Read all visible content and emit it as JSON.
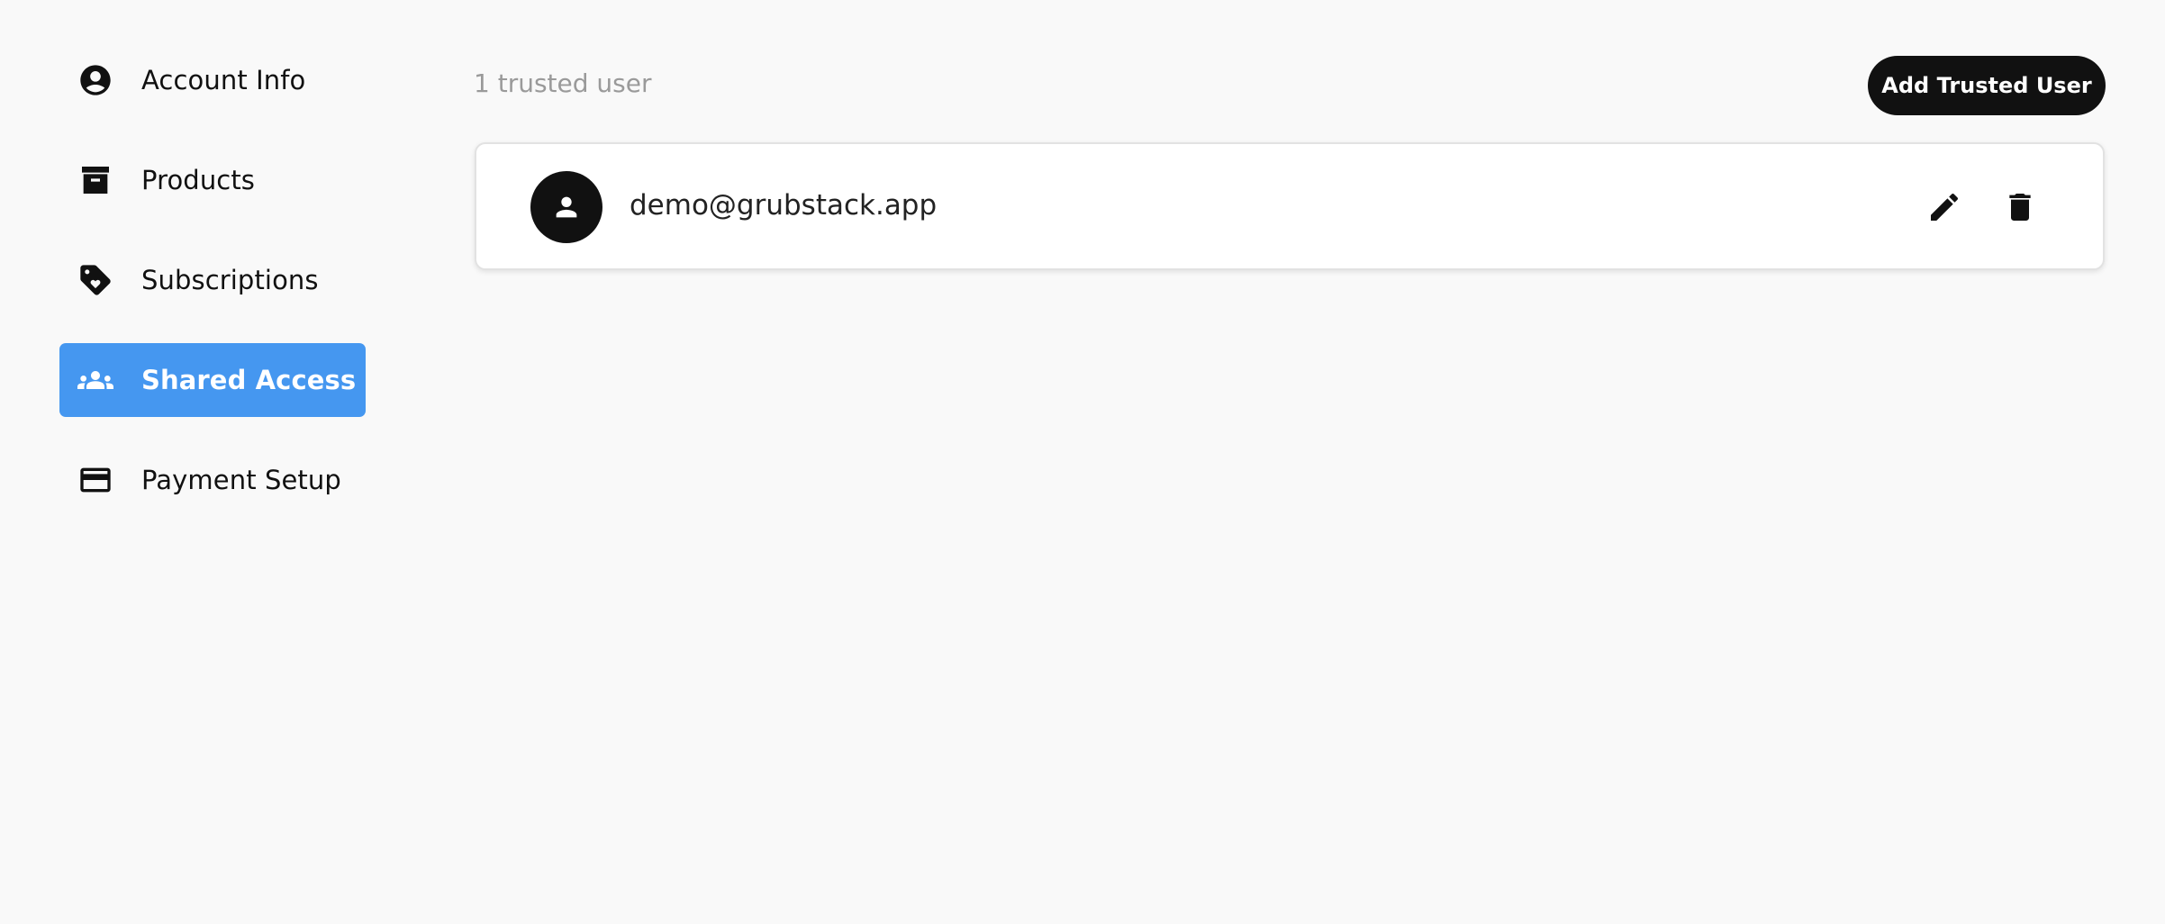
{
  "sidebar": {
    "items": [
      {
        "label": "Account Info",
        "icon": "account-circle-icon",
        "active": false
      },
      {
        "label": "Products",
        "icon": "archive-box-icon",
        "active": false
      },
      {
        "label": "Subscriptions",
        "icon": "tag-heart-icon",
        "active": false
      },
      {
        "label": "Shared Access",
        "icon": "group-icon",
        "active": true
      },
      {
        "label": "Payment Setup",
        "icon": "credit-card-icon",
        "active": false
      }
    ]
  },
  "main": {
    "count_text": "1 trusted user",
    "add_button_label": "Add Trusted User",
    "users": [
      {
        "email": "demo@grubstack.app",
        "icon": "person-icon"
      }
    ],
    "actions": {
      "edit_icon": "pencil-icon",
      "delete_icon": "trash-icon"
    }
  },
  "colors": {
    "accent": "#4597f0",
    "background": "#f9f9f9",
    "button": "#111111",
    "muted_text": "#9a9a9a"
  }
}
